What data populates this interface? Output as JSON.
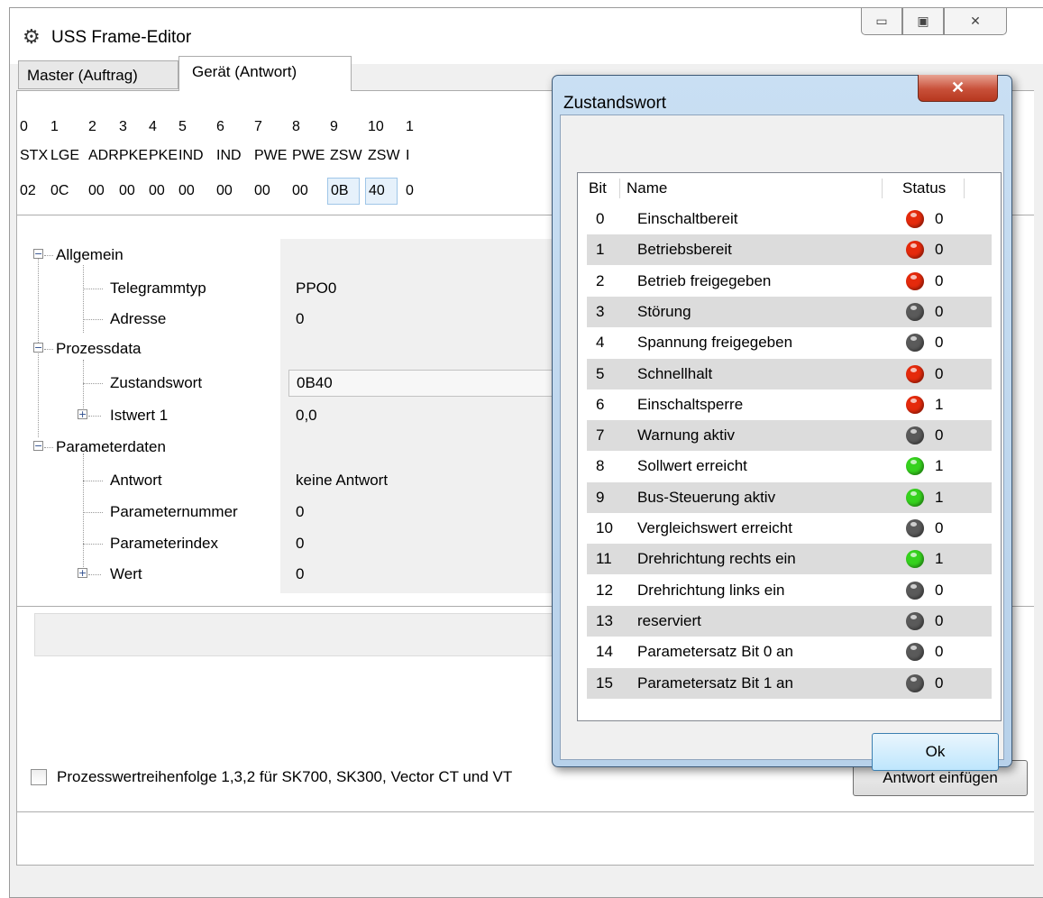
{
  "window": {
    "title": "USS Frame-Editor",
    "icon": "gear-icon",
    "min_glyph": "▭",
    "max_glyph": "▣",
    "close_glyph": "✕"
  },
  "tabs": [
    {
      "label": "Master (Auftrag)",
      "active": false
    },
    {
      "label": "Gerät (Antwort)",
      "active": true
    }
  ],
  "byte_grid": {
    "indices": [
      "0",
      "1",
      "2",
      "3",
      "4",
      "5",
      "6",
      "7",
      "8",
      "9",
      "10",
      "1"
    ],
    "names": [
      "STX",
      "LGE",
      "ADR",
      "PKE",
      "PKE",
      "IND",
      "IND",
      "PWE",
      "PWE",
      "ZSW",
      "ZSW",
      "I"
    ],
    "values": [
      "02",
      "0C",
      "00",
      "00",
      "00",
      "00",
      "00",
      "00",
      "00",
      "0B",
      "40",
      "0"
    ],
    "highlighted": [
      9,
      10
    ]
  },
  "tree": {
    "allgemein": {
      "label": "Allgemein",
      "toggle": "−"
    },
    "telegrammtyp": {
      "label": "Telegrammtyp",
      "value": "PPO0"
    },
    "adresse": {
      "label": "Adresse",
      "value": "0"
    },
    "prozessdata": {
      "label": "Prozessdata",
      "toggle": "−"
    },
    "zustandswort": {
      "label": "Zustandswort",
      "value": "0B40"
    },
    "istwert1": {
      "label": "Istwert 1",
      "value": "0,0",
      "toggle": "+"
    },
    "parameterdaten": {
      "label": "Parameterdaten",
      "toggle": "−"
    },
    "antwort": {
      "label": "Antwort",
      "value": "keine Antwort"
    },
    "parameternummer": {
      "label": "Parameternummer",
      "value": "0"
    },
    "parameterindex": {
      "label": "Parameterindex",
      "value": "0"
    },
    "wert": {
      "label": "Wert",
      "value": "0",
      "toggle": "+"
    }
  },
  "bottom": {
    "checkbox_label": "Prozesswertreihenfolge 1,3,2 für SK700, SK300, Vector CT und VT",
    "checkbox_checked": false,
    "insert_button": "Antwort einfügen"
  },
  "dialog": {
    "title": "Zustandswort",
    "close_glyph": "✕",
    "columns": {
      "bit": "Bit",
      "name": "Name",
      "status": "Status"
    },
    "ok_label": "Ok",
    "led_colors": {
      "red": "#e52a0c",
      "green": "#36d21e",
      "gray": "#5a5a5a"
    },
    "bits": [
      {
        "bit": "0",
        "name": "Einschaltbereit",
        "led": "red",
        "status": "0"
      },
      {
        "bit": "1",
        "name": "Betriebsbereit",
        "led": "red",
        "status": "0"
      },
      {
        "bit": "2",
        "name": "Betrieb freigegeben",
        "led": "red",
        "status": "0"
      },
      {
        "bit": "3",
        "name": "Störung",
        "led": "gray",
        "status": "0"
      },
      {
        "bit": "4",
        "name": "Spannung freigegeben",
        "led": "gray",
        "status": "0"
      },
      {
        "bit": "5",
        "name": "Schnellhalt",
        "led": "red",
        "status": "0"
      },
      {
        "bit": "6",
        "name": "Einschaltsperre",
        "led": "red",
        "status": "1"
      },
      {
        "bit": "7",
        "name": "Warnung aktiv",
        "led": "gray",
        "status": "0"
      },
      {
        "bit": "8",
        "name": "Sollwert erreicht",
        "led": "green",
        "status": "1"
      },
      {
        "bit": "9",
        "name": "Bus-Steuerung aktiv",
        "led": "green",
        "status": "1"
      },
      {
        "bit": "10",
        "name": "Vergleichswert erreicht",
        "led": "gray",
        "status": "0"
      },
      {
        "bit": "11",
        "name": "Drehrichtung rechts ein",
        "led": "green",
        "status": "1"
      },
      {
        "bit": "12",
        "name": "Drehrichtung links ein",
        "led": "gray",
        "status": "0"
      },
      {
        "bit": "13",
        "name": "reserviert",
        "led": "gray",
        "status": "0"
      },
      {
        "bit": "14",
        "name": "Parametersatz Bit 0 an",
        "led": "gray",
        "status": "0"
      },
      {
        "bit": "15",
        "name": "Parametersatz Bit 1 an",
        "led": "gray",
        "status": "0"
      }
    ]
  }
}
